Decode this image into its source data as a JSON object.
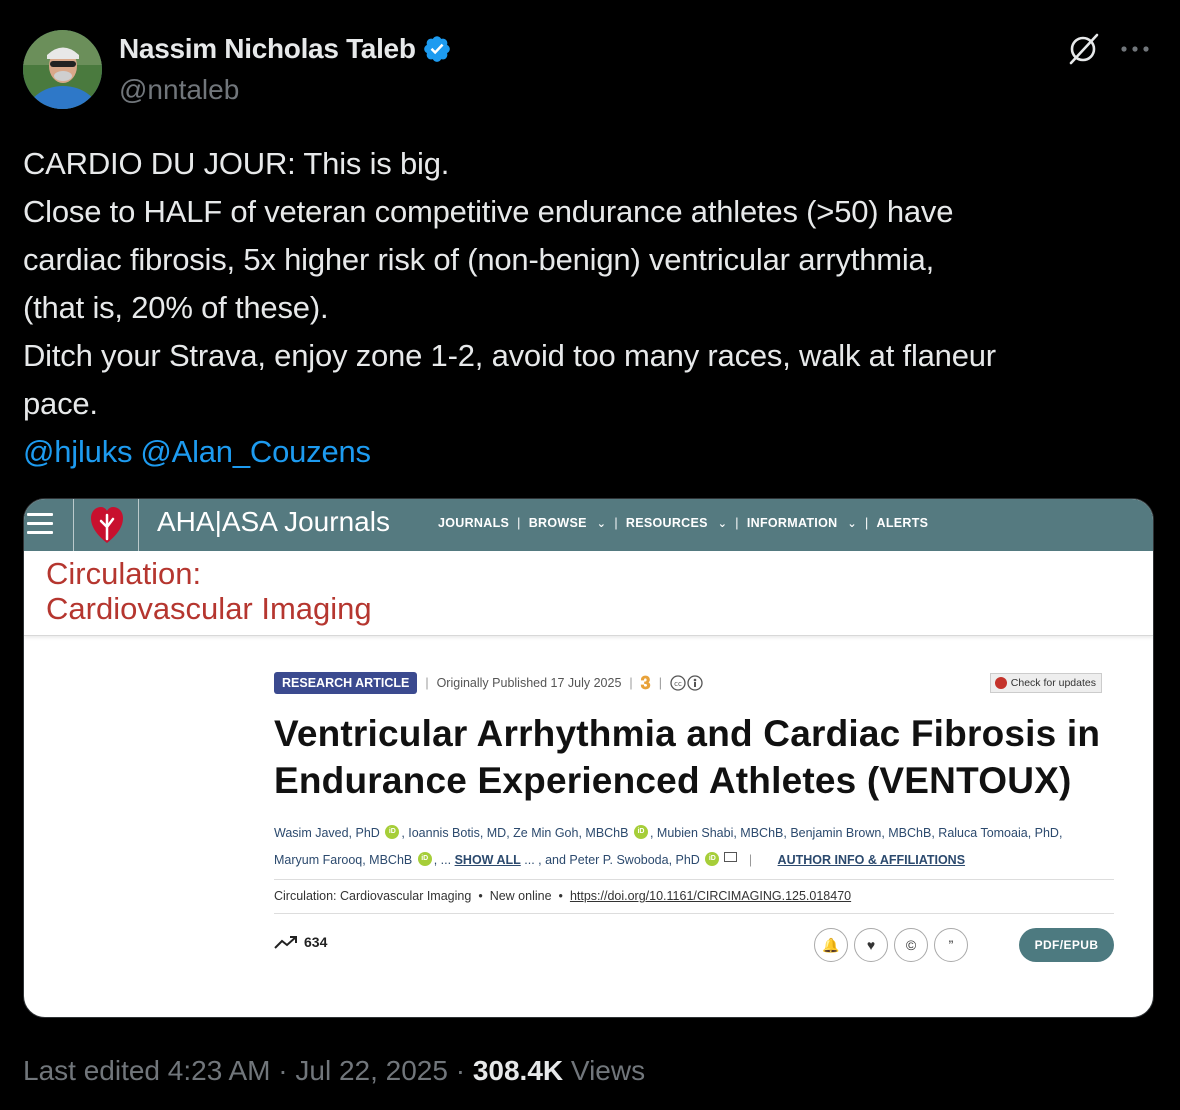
{
  "author": {
    "name": "Nassim Nicholas Taleb",
    "handle": "@nntaleb"
  },
  "tweet": {
    "lines": [
      "CARDIO DU JOUR: This is big.",
      "Close to HALF of veteran competitive endurance athletes (>50) have",
      "cardiac fibrosis, 5x higher risk of (non-benign) ventricular arrythmia,",
      "(that is, 20% of these).",
      "Ditch your Strava, enjoy zone 1-2, avoid too many races, walk at flaneur",
      "pace."
    ],
    "mentions": [
      "@hjluks",
      "@Alan_Couzens"
    ]
  },
  "media": {
    "brand": "AHA|ASA Journals",
    "nav": [
      "JOURNALS",
      "BROWSE",
      "RESOURCES",
      "INFORMATION",
      "ALERTS"
    ],
    "journal_title_line1": "Circulation:",
    "journal_title_line2": "Cardiovascular Imaging",
    "badge": "RESEARCH ARTICLE",
    "published": "Originally Published 17 July 2025",
    "check_updates": "Check for updates",
    "article_title": "Ventricular Arrhythmia and Cardiac Fibrosis in Endurance Experienced Athletes (VENTOUX)",
    "authors_line1": {
      "a1": "Wasim Javed, PhD",
      "a2": ", Ioannis Botis, MD, Ze Min Goh, MBChB",
      "a3": ", Mubien Shabi, MBChB, Benjamin Brown, MBChB, Raluca Tomoaia, PhD,"
    },
    "authors_line2": {
      "a1": "Maryum Farooq, MBChB",
      "a2": ", ...",
      "show_all": "SHOW ALL",
      "a3": "... , and Peter P. Swoboda, PhD",
      "affiliations": "AUTHOR INFO & AFFILIATIONS"
    },
    "citation": {
      "journal": "Circulation: Cardiovascular Imaging",
      "status": "New online",
      "doi": "https://doi.org/10.1161/CIRCIMAGING.125.018470"
    },
    "metric_count": "634",
    "pdf_button": "PDF/EPUB"
  },
  "footer": {
    "edited": "Last edited 4:23 AM · Jul 22, 2025 · ",
    "views_count": "308.4K",
    "views_label": " Views"
  },
  "colors": {
    "background": "#000000",
    "link": "#1d9bf0",
    "verified": "#1d9bf0",
    "aha_bar": "#557a80",
    "journal_red": "#b5362f",
    "badge": "#3b4a8f"
  }
}
